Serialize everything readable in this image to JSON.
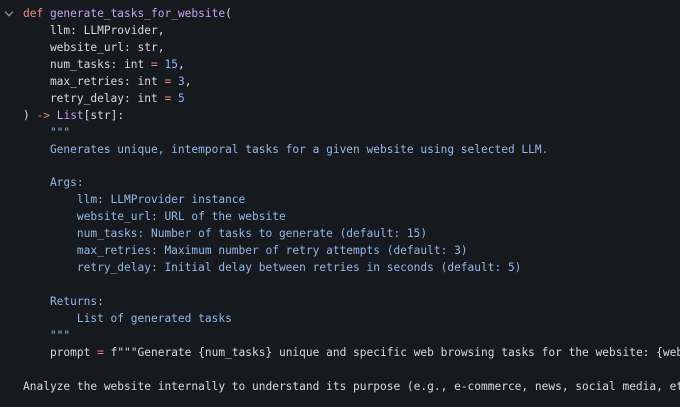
{
  "editor": {
    "fold_icon": "chevron-down-icon",
    "lines": [
      {
        "segs": [
          {
            "t": "def ",
            "c": "kw"
          },
          {
            "t": "generate_tasks_for_website",
            "c": "fn"
          },
          {
            "t": "(",
            "c": "txt"
          }
        ]
      },
      {
        "segs": [
          {
            "t": "    llm: LLMProvider,",
            "c": "txt"
          }
        ]
      },
      {
        "segs": [
          {
            "t": "    website_url: str,",
            "c": "txt"
          }
        ]
      },
      {
        "segs": [
          {
            "t": "    num_tasks: int ",
            "c": "txt"
          },
          {
            "t": "=",
            "c": "op"
          },
          {
            "t": " ",
            "c": "txt"
          },
          {
            "t": "15",
            "c": "num"
          },
          {
            "t": ",",
            "c": "txt"
          }
        ]
      },
      {
        "segs": [
          {
            "t": "    max_retries: int ",
            "c": "txt"
          },
          {
            "t": "=",
            "c": "op"
          },
          {
            "t": " ",
            "c": "txt"
          },
          {
            "t": "3",
            "c": "num"
          },
          {
            "t": ",",
            "c": "txt"
          }
        ]
      },
      {
        "segs": [
          {
            "t": "    retry_delay: int ",
            "c": "txt"
          },
          {
            "t": "=",
            "c": "op"
          },
          {
            "t": " ",
            "c": "txt"
          },
          {
            "t": "5",
            "c": "num"
          }
        ]
      },
      {
        "segs": [
          {
            "t": ") ",
            "c": "txt"
          },
          {
            "t": "->",
            "c": "op"
          },
          {
            "t": " ",
            "c": "txt"
          },
          {
            "t": "List",
            "c": "fn"
          },
          {
            "t": "[str]:",
            "c": "txt"
          }
        ]
      },
      {
        "segs": [
          {
            "t": "    \"\"\"",
            "c": "doc"
          }
        ]
      },
      {
        "segs": [
          {
            "t": "    Generates unique, intemporal tasks for a given website using selected LLM.",
            "c": "doc"
          }
        ]
      },
      {
        "segs": [
          {
            "t": "",
            "c": "txt"
          }
        ]
      },
      {
        "segs": [
          {
            "t": "    Args:",
            "c": "doc"
          }
        ]
      },
      {
        "segs": [
          {
            "t": "        llm: LLMProvider instance",
            "c": "doc"
          }
        ]
      },
      {
        "segs": [
          {
            "t": "        website_url: URL of the website",
            "c": "doc"
          }
        ]
      },
      {
        "segs": [
          {
            "t": "        num_tasks: Number of tasks to generate (default: 15)",
            "c": "doc"
          }
        ]
      },
      {
        "segs": [
          {
            "t": "        max_retries: Maximum number of retry attempts (default: 3)",
            "c": "doc"
          }
        ]
      },
      {
        "segs": [
          {
            "t": "        retry_delay: Initial delay between retries in seconds (default: 5)",
            "c": "doc"
          }
        ]
      },
      {
        "segs": [
          {
            "t": "",
            "c": "txt"
          }
        ]
      },
      {
        "segs": [
          {
            "t": "    Returns:",
            "c": "doc"
          }
        ]
      },
      {
        "segs": [
          {
            "t": "        List of generated tasks",
            "c": "doc"
          }
        ]
      },
      {
        "segs": [
          {
            "t": "    \"\"\"",
            "c": "doc"
          }
        ]
      },
      {
        "segs": [
          {
            "t": "    prompt ",
            "c": "txt"
          },
          {
            "t": "=",
            "c": "op"
          },
          {
            "t": " f\"\"\"Generate {num_tasks} unique and specific web browsing tasks for the website: {website_url}",
            "c": "txt"
          }
        ]
      },
      {
        "segs": [
          {
            "t": "",
            "c": "txt"
          }
        ]
      },
      {
        "segs": [
          {
            "t": "Analyze the website internally to understand its purpose (e.g., e-commerce, news, social media, etc.) and g",
            "c": "txt"
          }
        ]
      }
    ]
  }
}
